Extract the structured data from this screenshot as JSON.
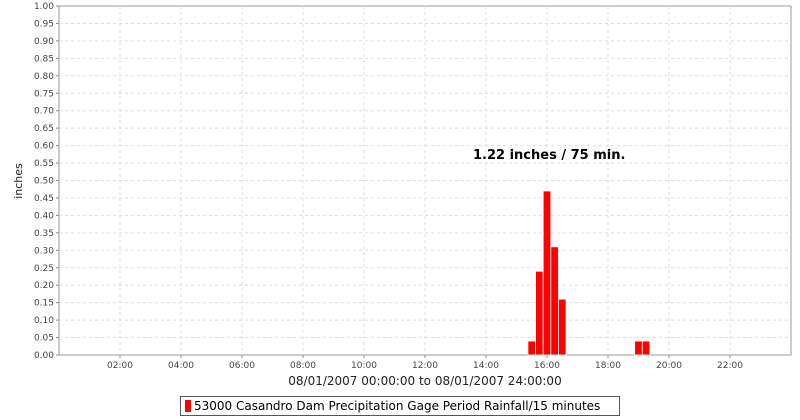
{
  "chart_data": {
    "type": "bar",
    "xlabel": "08/01/2007 00:00:00 to 08/01/2007 24:00:00",
    "ylabel": "inches",
    "ylim": [
      0,
      1.0
    ],
    "yticks": [
      "0.00",
      "0.05",
      "0.10",
      "0.15",
      "0.20",
      "0.25",
      "0.30",
      "0.35",
      "0.40",
      "0.45",
      "0.50",
      "0.55",
      "0.60",
      "0.65",
      "0.70",
      "0.75",
      "0.80",
      "0.85",
      "0.90",
      "0.95",
      "1.00"
    ],
    "xlim": [
      "00:00",
      "24:00"
    ],
    "xticks": [
      "02:00",
      "04:00",
      "06:00",
      "08:00",
      "10:00",
      "12:00",
      "14:00",
      "16:00",
      "18:00",
      "20:00",
      "22:00"
    ],
    "grid": true,
    "legend_position": "bottom",
    "annotation": "1.22 inches / 75 min.",
    "series": [
      {
        "name": "53000 Casandro Dam Precipitation Gage Period Rainfall/15 minutes",
        "color": "#ff0000",
        "points": [
          {
            "x": "15:30",
            "y": 0.04
          },
          {
            "x": "15:45",
            "y": 0.24
          },
          {
            "x": "16:00",
            "y": 0.47
          },
          {
            "x": "16:15",
            "y": 0.31
          },
          {
            "x": "16:30",
            "y": 0.16
          },
          {
            "x": "19:00",
            "y": 0.04
          },
          {
            "x": "19:15",
            "y": 0.04
          }
        ]
      }
    ]
  }
}
